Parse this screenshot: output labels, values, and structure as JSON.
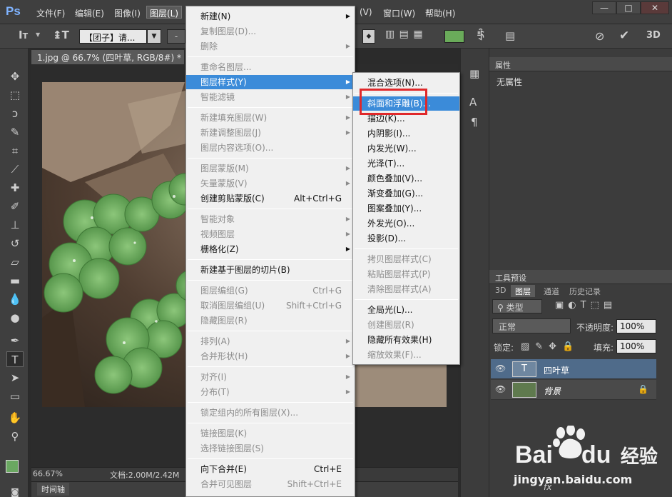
{
  "colors": {
    "accent": "#3b8bd9",
    "highlight_box": "#e0282a",
    "foreground_swatch": "#6aa861",
    "color_chip": "#6aab5a"
  },
  "menubar": {
    "items": [
      "文件(F)",
      "编辑(E)",
      "图像(I)",
      "图层(L)"
    ],
    "right_items": [
      "(V)",
      "窗口(W)",
      "帮助(H)"
    ],
    "window_buttons": [
      "—",
      "□",
      "✕"
    ]
  },
  "options": {
    "font_family": "【团子】请...",
    "dash": "-",
    "mode_3d": "3D"
  },
  "document": {
    "tab_title": "1.jpg @ 66.7% (四叶草, RGB/8#) *",
    "close": "×"
  },
  "status": {
    "zoom": "66.67%",
    "doc_size": "文档:2.00M/2.42M"
  },
  "timeline": {
    "label": "时间轴"
  },
  "layer_menu": [
    {
      "label": "新建(N)",
      "sub": true,
      "disabled": false
    },
    {
      "label": "复制图层(D)...",
      "disabled": true
    },
    {
      "label": "删除",
      "sub": true,
      "disabled": true
    },
    {
      "sep": true
    },
    {
      "label": "重命名图层...",
      "disabled": true
    },
    {
      "label": "图层样式(Y)",
      "sub": true,
      "highlight": true
    },
    {
      "label": "智能滤镜",
      "sub": true,
      "disabled": true
    },
    {
      "sep": true
    },
    {
      "label": "新建填充图层(W)",
      "sub": true,
      "disabled": true
    },
    {
      "label": "新建调整图层(J)",
      "sub": true,
      "disabled": true
    },
    {
      "label": "图层内容选项(O)...",
      "disabled": true
    },
    {
      "sep": true
    },
    {
      "label": "图层蒙版(M)",
      "sub": true,
      "disabled": true
    },
    {
      "label": "矢量蒙版(V)",
      "sub": true,
      "disabled": true
    },
    {
      "label": "创建剪贴蒙版(C)",
      "shortcut": "Alt+Ctrl+G"
    },
    {
      "sep": true
    },
    {
      "label": "智能对象",
      "sub": true,
      "disabled": true
    },
    {
      "label": "视频图层",
      "sub": true,
      "disabled": true
    },
    {
      "label": "栅格化(Z)",
      "sub": true
    },
    {
      "sep": true
    },
    {
      "label": "新建基于图层的切片(B)"
    },
    {
      "sep": true
    },
    {
      "label": "图层编组(G)",
      "shortcut": "Ctrl+G",
      "disabled": true
    },
    {
      "label": "取消图层编组(U)",
      "shortcut": "Shift+Ctrl+G",
      "disabled": true
    },
    {
      "label": "隐藏图层(R)",
      "disabled": true
    },
    {
      "sep": true
    },
    {
      "label": "排列(A)",
      "sub": true,
      "disabled": true
    },
    {
      "label": "合并形状(H)",
      "sub": true,
      "disabled": true
    },
    {
      "sep": true
    },
    {
      "label": "对齐(I)",
      "sub": true,
      "disabled": true
    },
    {
      "label": "分布(T)",
      "sub": true,
      "disabled": true
    },
    {
      "sep": true
    },
    {
      "label": "锁定组内的所有图层(X)...",
      "disabled": true
    },
    {
      "sep": true
    },
    {
      "label": "链接图层(K)",
      "disabled": true
    },
    {
      "label": "选择链接图层(S)",
      "disabled": true
    },
    {
      "sep": true
    },
    {
      "label": "向下合并(E)",
      "shortcut": "Ctrl+E"
    },
    {
      "label": "合并可见图层",
      "shortcut": "Shift+Ctrl+E",
      "disabled": true
    }
  ],
  "style_submenu": [
    {
      "label": "混合选项(N)..."
    },
    {
      "sep": true
    },
    {
      "label": "斜面和浮雕(B)...",
      "highlight": true
    },
    {
      "label": "描边(K)..."
    },
    {
      "label": "内阴影(I)..."
    },
    {
      "label": "内发光(W)..."
    },
    {
      "label": "光泽(T)..."
    },
    {
      "label": "颜色叠加(V)..."
    },
    {
      "label": "渐变叠加(G)..."
    },
    {
      "label": "图案叠加(Y)..."
    },
    {
      "label": "外发光(O)..."
    },
    {
      "label": "投影(D)..."
    },
    {
      "sep": true
    },
    {
      "label": "拷贝图层样式(C)",
      "disabled": true
    },
    {
      "label": "粘贴图层样式(P)",
      "disabled": true
    },
    {
      "label": "清除图层样式(A)",
      "disabled": true
    },
    {
      "sep": true
    },
    {
      "label": "全局光(L)..."
    },
    {
      "label": "创建图层(R)",
      "disabled": true
    },
    {
      "label": "隐藏所有效果(H)"
    },
    {
      "label": "缩放效果(F)...",
      "disabled": true
    }
  ],
  "properties": {
    "title": "属性",
    "body": "无属性"
  },
  "tool_presets": {
    "title": "工具预设"
  },
  "layers_panel": {
    "tabs": [
      "3D",
      "图层",
      "通道",
      "历史记录"
    ],
    "filter": "类型",
    "filter_icons": [
      "T"
    ],
    "blend_mode": "正常",
    "opacity_label": "不透明度:",
    "opacity": "100%",
    "lock_label": "锁定:",
    "fill_label": "填充:",
    "fill": "100%",
    "layers": [
      {
        "name": "四叶草",
        "type": "text"
      },
      {
        "name": "背景",
        "type": "image"
      }
    ],
    "footer_text": "fx"
  },
  "watermark": {
    "brand": "Bai",
    "brand_suffix": "du",
    "label": "经验",
    "url": "jingyan.baidu.com"
  }
}
